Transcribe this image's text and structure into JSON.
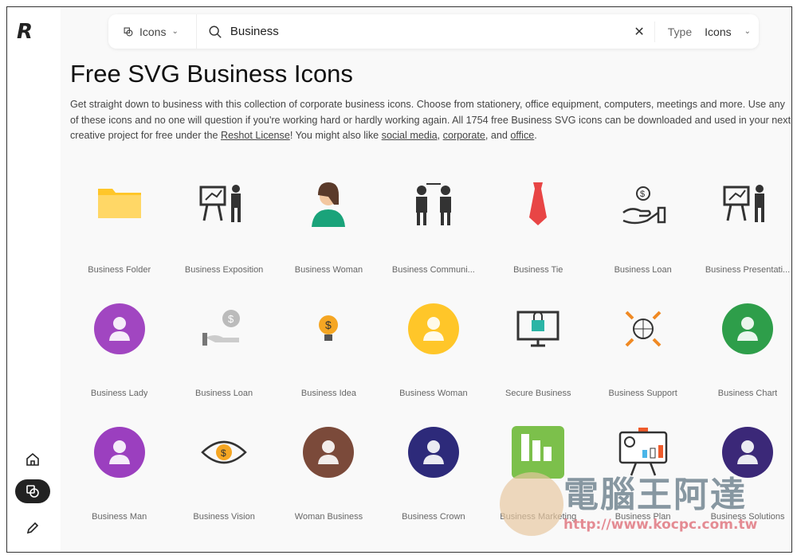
{
  "sidebar": {
    "logo": "R",
    "items": [
      {
        "name": "home",
        "icon": "home-icon"
      },
      {
        "name": "icons",
        "icon": "shapes-icon",
        "active": true
      },
      {
        "name": "edit",
        "icon": "pencil-icon"
      }
    ]
  },
  "search": {
    "category": "Icons",
    "query": "Business",
    "type_label": "Type",
    "type_value": "Icons"
  },
  "page": {
    "title": "Free SVG Business Icons",
    "desc_1": "Get straight down to business with this collection of corporate business icons. Choose from stationery, office equipment, computers, meetings and more. Use any of these icons and no one will question if you're working hard or hardly working again. All 1754 free Business SVG icons can be downloaded and used in your next creative project for free under the ",
    "license_link": "Reshot License",
    "desc_2": "! You might also like ",
    "link_social": "social media",
    "sep1": ", ",
    "link_corporate": "corporate",
    "sep2": ", and ",
    "link_office": "office",
    "end": "."
  },
  "icons": [
    {
      "label": "Business Folder",
      "kind": "folder",
      "color": "#ffc629"
    },
    {
      "label": "Business Exposition",
      "kind": "board",
      "color": "#333333"
    },
    {
      "label": "Business Woman",
      "kind": "woman",
      "color": "#1aa37a"
    },
    {
      "label": "Business Communi...",
      "kind": "people",
      "color": "#333333"
    },
    {
      "label": "Business Tie",
      "kind": "tie",
      "color": "#e84545"
    },
    {
      "label": "Business Loan",
      "kind": "hand",
      "color": "#333333"
    },
    {
      "label": "Business Presentati...",
      "kind": "board",
      "color": "#333333"
    },
    {
      "label": "Business Lady",
      "kind": "circle",
      "color": "#a146c1"
    },
    {
      "label": "Business Loan",
      "kind": "coinhand",
      "color": "#999999"
    },
    {
      "label": "Business Idea",
      "kind": "bulb",
      "color": "#f5a623"
    },
    {
      "label": "Business Woman",
      "kind": "circle",
      "color": "#ffc629"
    },
    {
      "label": "Secure Business",
      "kind": "monitor",
      "color": "#2bb5a6"
    },
    {
      "label": "Business Support",
      "kind": "globe",
      "color": "#f08a24"
    },
    {
      "label": "Business Chart",
      "kind": "circle",
      "color": "#2e9e4a"
    },
    {
      "label": "Business Man",
      "kind": "circle",
      "color": "#9b3fbf"
    },
    {
      "label": "Business Vision",
      "kind": "eye",
      "color": "#f5a623"
    },
    {
      "label": "Woman Business",
      "kind": "circle",
      "color": "#7b4a3a"
    },
    {
      "label": "Business Crown",
      "kind": "circle",
      "color": "#2d2a7a"
    },
    {
      "label": "Business Marketing",
      "kind": "square",
      "color": "#7cc04b"
    },
    {
      "label": "Business Plan",
      "kind": "board2",
      "color": "#ef5b2b"
    },
    {
      "label": "Business Solutions",
      "kind": "circle",
      "color": "#3b2878"
    }
  ],
  "watermark": {
    "title": "電腦王阿達",
    "url": "http://www.kocpc.com.tw"
  }
}
